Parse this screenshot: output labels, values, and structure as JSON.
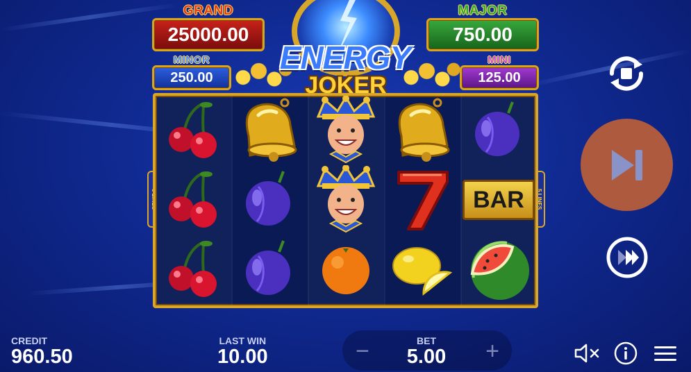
{
  "game": {
    "title_line1": "ENERGY",
    "title_line2": "JOKER",
    "paylines_label_left": "5 LINES",
    "paylines_label_right": "5 LINES"
  },
  "jackpots": {
    "grand": {
      "label": "GRAND",
      "value": "25000.00"
    },
    "major": {
      "label": "MAJOR",
      "value": "750.00"
    },
    "minor": {
      "label": "MINOR",
      "value": "250.00"
    },
    "mini": {
      "label": "MINI",
      "value": "125.00"
    }
  },
  "reels": [
    [
      "cherry",
      "cherry",
      "cherry"
    ],
    [
      "bell",
      "plum",
      "plum"
    ],
    [
      "joker",
      "joker",
      "orange"
    ],
    [
      "bell",
      "seven",
      "lemon"
    ],
    [
      "plum",
      "bar",
      "watermelon"
    ]
  ],
  "bar_symbol_text": "BAR",
  "stats": {
    "credit": {
      "label": "CREDIT",
      "value": "960.50"
    },
    "last_win": {
      "label": "LAST WIN",
      "value": "10.00"
    },
    "bet": {
      "label": "BET",
      "value": "5.00"
    }
  },
  "bet_controls": {
    "decrease": "−",
    "increase": "+"
  },
  "icons": {
    "autoplay": "autoplay-icon",
    "spin": "skip-forward-icon",
    "turbo": "fast-forward-icon",
    "sound": "sound-muted-icon",
    "info": "info-icon",
    "menu": "hamburger-menu-icon"
  },
  "colors": {
    "background": "#102a92",
    "gold_frame": "#d8a628",
    "spin_button": "#ad5a3e",
    "grand": "#c8221a",
    "major": "#38a83c",
    "minor": "#2c5fe0",
    "mini": "#a23ad0"
  }
}
